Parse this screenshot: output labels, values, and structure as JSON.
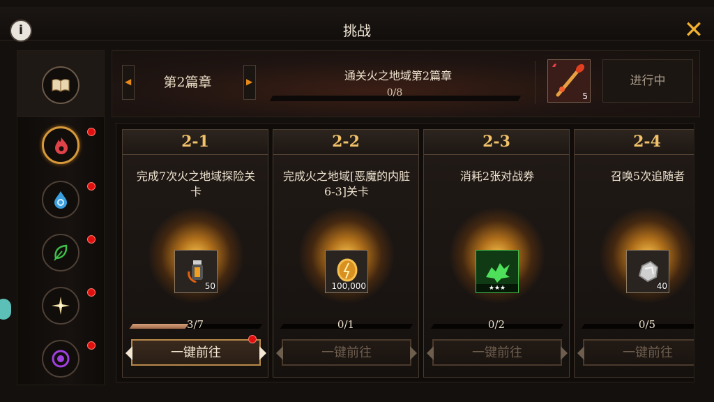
{
  "header": {
    "title": "挑战",
    "info_icon": "i",
    "close_icon": "✕"
  },
  "sidebar": {
    "items": [
      {
        "name": "book",
        "icon": "book-icon",
        "badge": false,
        "active": false
      },
      {
        "name": "fire",
        "icon": "fire-element-icon",
        "color": "#e0424a",
        "badge": true,
        "active": true
      },
      {
        "name": "water",
        "icon": "water-element-icon",
        "color": "#3aa0e0",
        "badge": true,
        "active": false
      },
      {
        "name": "nature",
        "icon": "leaf-element-icon",
        "color": "#3ec04a",
        "badge": true,
        "active": false
      },
      {
        "name": "light",
        "icon": "sun-element-icon",
        "color": "#f2e0a0",
        "badge": true,
        "active": false
      },
      {
        "name": "dark",
        "icon": "dark-element-icon",
        "color": "#a040e0",
        "badge": true,
        "active": false
      }
    ]
  },
  "chapter": {
    "name": "第2篇章",
    "goal": "通关火之地域第2篇章",
    "progress": "0/8",
    "reward_qty": "5",
    "status": "进行中"
  },
  "cards": [
    {
      "num": "2-1",
      "desc": "完成7次火之地域探险关卡",
      "qty": "50",
      "progress": "3/7",
      "fill": 0.4286,
      "button": "一键前往",
      "enabled": true,
      "badge": true
    },
    {
      "num": "2-2",
      "desc": "完成火之地域[恶魔的内脏6-3]关卡",
      "qty": "100,000",
      "progress": "0/1",
      "fill": 0,
      "button": "一键前往",
      "enabled": false,
      "badge": false
    },
    {
      "num": "2-3",
      "desc": "消耗2张对战券",
      "qty": "★★★",
      "progress": "0/2",
      "fill": 0,
      "button": "一键前往",
      "enabled": false,
      "badge": false
    },
    {
      "num": "2-4",
      "desc": "召唤5次追随者",
      "qty": "40",
      "progress": "0/5",
      "fill": 0,
      "button": "一键前往",
      "enabled": false,
      "badge": false
    }
  ],
  "colors": {
    "accent": "#f0b030",
    "badge": "#e01010"
  }
}
